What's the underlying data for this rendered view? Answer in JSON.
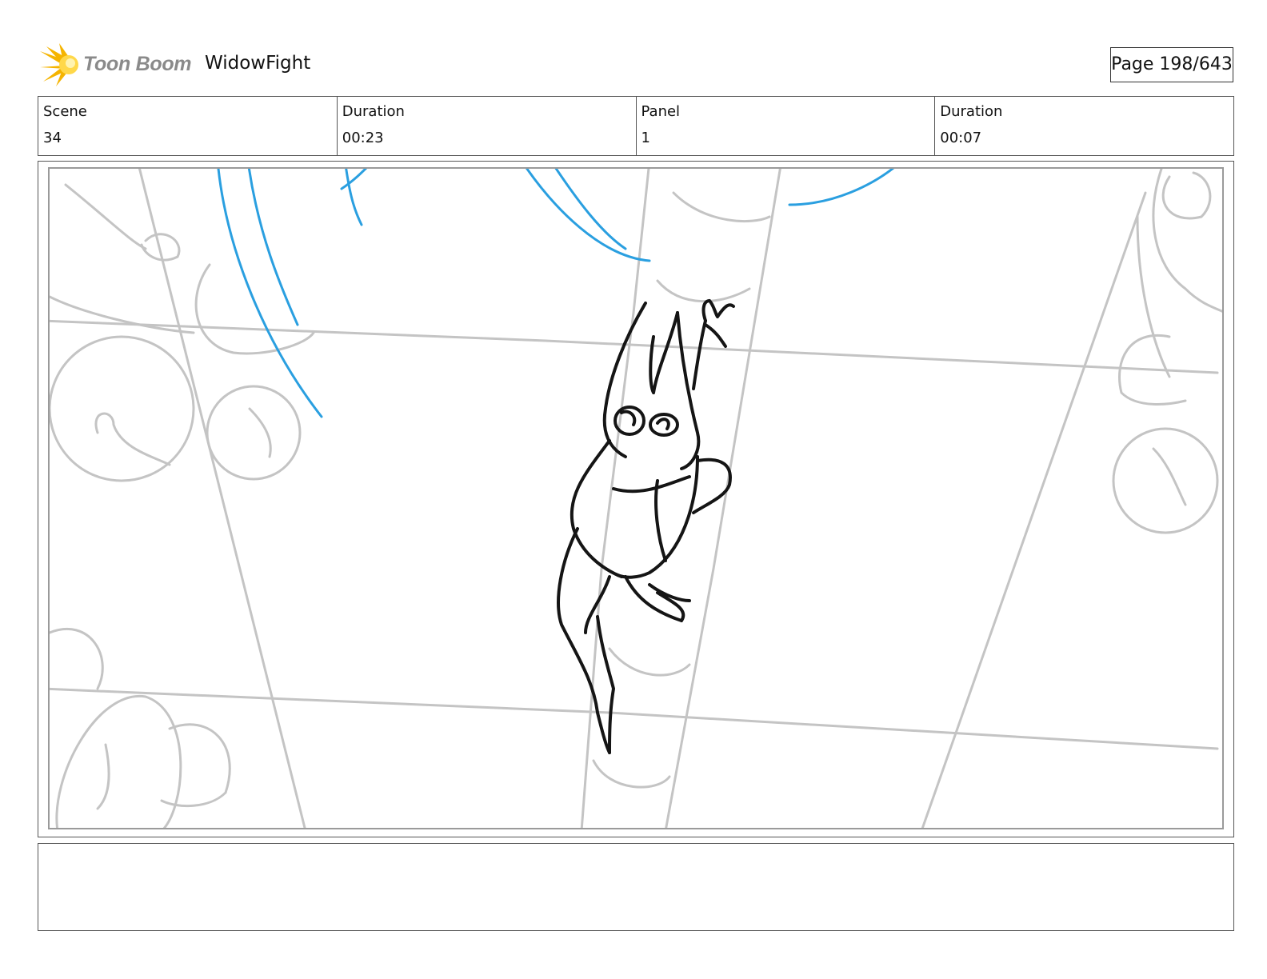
{
  "header": {
    "logo_text": "Toon Boom",
    "project_title": "WidowFight",
    "page_label": "Page 198/643"
  },
  "info": {
    "scene_label": "Scene",
    "scene_value": "34",
    "scene_duration_label": "Duration",
    "scene_duration_value": "00:23",
    "panel_label": "Panel",
    "panel_value": "1",
    "panel_duration_label": "Duration",
    "panel_duration_value": "00:07"
  },
  "panel": {
    "image_icon": "storyboard-sketch",
    "line_colors": {
      "ink": "#111111",
      "background": "#bdbdbd",
      "blue": "#2a9fe0"
    }
  },
  "notes": {
    "text": ""
  }
}
